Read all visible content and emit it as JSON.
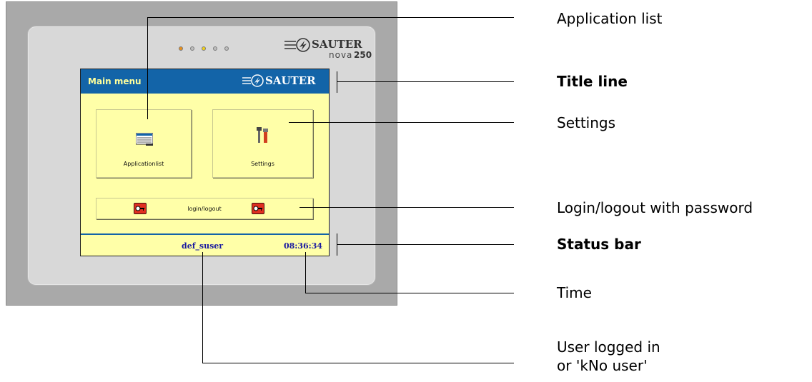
{
  "device": {
    "brand_logo": "SAUTER",
    "model": "nova",
    "model_number": "250",
    "led_colors": [
      "#e8901c",
      "#bdbdbd",
      "#f2d21a",
      "#bdbdbd",
      "#bdbdbd"
    ]
  },
  "screen": {
    "title": "Main menu",
    "logo": "SAUTER",
    "tiles": [
      {
        "label": "Applicationlist",
        "icon": "list-icon"
      },
      {
        "label": "Settings",
        "icon": "tools-icon"
      }
    ],
    "login_label": "login/logout",
    "user": "def_suser",
    "time": "08:36:34"
  },
  "callouts": [
    {
      "text": "Application list",
      "bold": false
    },
    {
      "text": "Title line",
      "bold": true
    },
    {
      "text": "Settings",
      "bold": false
    },
    {
      "text": "Login/logout with password",
      "bold": false
    },
    {
      "text": "Status bar",
      "bold": true
    },
    {
      "text": "Time",
      "bold": false
    },
    {
      "text_line1": "User logged in",
      "text_line2": "or 'kNo user'",
      "bold": false
    }
  ],
  "colors": {
    "title_bar": "#1364a8",
    "screen_bg": "#ffffa8",
    "status_text": "#1a1aa0",
    "title_text": "#ffff9c"
  }
}
